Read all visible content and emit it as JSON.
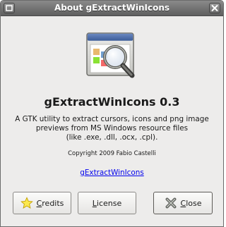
{
  "window": {
    "title": "About gExtractWinIcons"
  },
  "about": {
    "app_name": "gExtractWinIcons 0.3",
    "description_lines": [
      "A GTK utility to extract cursors, icons and png image",
      "previews from MS Windows resource files",
      "(like .exe, .dll, .ocx, .cpl)."
    ],
    "copyright": "Copyright 2009 Fabio Castelli",
    "website": "gExtractWinIcons"
  },
  "buttons": {
    "credits": "Credits",
    "license": "License",
    "close": "Close"
  },
  "icons": {
    "window_menu": "square-icon",
    "window_close": "close-icon",
    "logo": "magnifier-window-icon",
    "credits": "star-icon",
    "close": "close-x-icon"
  }
}
